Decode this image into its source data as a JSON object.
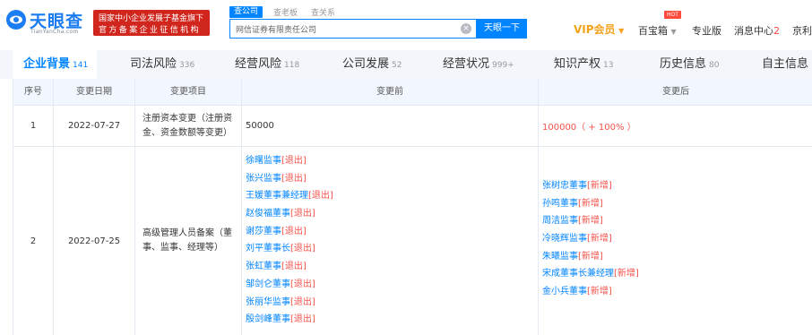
{
  "logo": {
    "text": "天眼查",
    "sub": "TianYanCha.com"
  },
  "banner": {
    "line1": "国家中小企业发展子基金旗下",
    "line2": "官方备案企业征信机构"
  },
  "search": {
    "tabs": [
      "查公司",
      "查老板",
      "查关系"
    ],
    "value": "网信证券有限责任公司",
    "button": "天眼一下"
  },
  "top_nav": {
    "vip": "VIP会员",
    "treasure": "百宝箱",
    "hot": "HOT",
    "pro": "专业版",
    "messages": "消息中心",
    "messages_count": "2",
    "user": "京利"
  },
  "tabs": [
    {
      "label": "企业背景",
      "count": "141",
      "active": true
    },
    {
      "label": "司法风险",
      "count": "336",
      "active": false
    },
    {
      "label": "经营风险",
      "count": "118",
      "active": false
    },
    {
      "label": "公司发展",
      "count": "52",
      "active": false
    },
    {
      "label": "经营状况",
      "count": "999+",
      "active": false
    },
    {
      "label": "知识产权",
      "count": "13",
      "active": false
    },
    {
      "label": "历史信息",
      "count": "80",
      "active": false
    },
    {
      "label": "自主信息",
      "count": "",
      "active": false
    }
  ],
  "table": {
    "headers": [
      "序号",
      "变更日期",
      "变更项目",
      "变更前",
      "变更后"
    ],
    "rows": [
      {
        "index": "1",
        "date": "2022-07-27",
        "item": "注册资本变更（注册资金、资金数额等变更）",
        "before": "50000",
        "after": "100000（ + 100% ）"
      },
      {
        "index": "2",
        "date": "2022-07-25",
        "item": "高级管理人员备案（董事、监事、经理等）",
        "before": [
          {
            "name": "徐曙监事",
            "tag": "[退出]"
          },
          {
            "name": "张兴监事",
            "tag": "[退出]"
          },
          {
            "name": "王媛董事兼经理",
            "tag": "[退出]"
          },
          {
            "name": "赵俊福董事",
            "tag": "[退出]"
          },
          {
            "name": "谢莎董事",
            "tag": "[退出]"
          },
          {
            "name": "刘平董事长",
            "tag": "[退出]"
          },
          {
            "name": "张虹董事",
            "tag": "[退出]"
          },
          {
            "name": "邹剑仑董事",
            "tag": "[退出]"
          },
          {
            "name": "张丽华监事",
            "tag": "[退出]"
          },
          {
            "name": "殷剑峰董事",
            "tag": "[退出]"
          }
        ],
        "after": [
          {
            "name": "张树忠董事",
            "tag": "[新增]"
          },
          {
            "name": "孙鸣董事",
            "tag": "[新增]"
          },
          {
            "name": "周洁监事",
            "tag": "[新增]"
          },
          {
            "name": "冷晓辉监事",
            "tag": "[新增]"
          },
          {
            "name": "朱曦监事",
            "tag": "[新增]"
          },
          {
            "name": "宋成董事长兼经理",
            "tag": "[新增]"
          },
          {
            "name": "金小兵董事",
            "tag": "[新增]"
          }
        ]
      }
    ]
  },
  "colors": {
    "brand": "#0084ff",
    "banner": "#d0261d",
    "vip": "#f4a21c",
    "alert": "#f5524b"
  }
}
